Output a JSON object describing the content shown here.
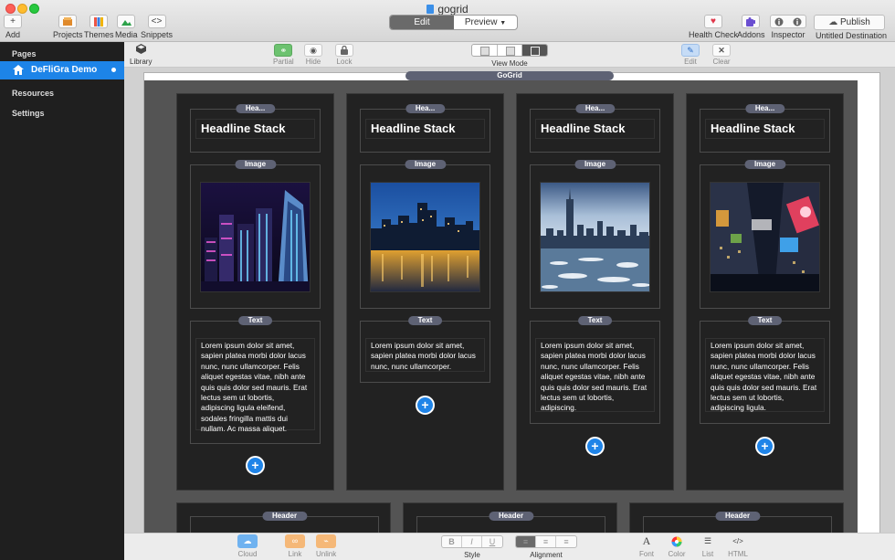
{
  "window": {
    "title": "gogrid"
  },
  "toolbar": {
    "add": "Add",
    "projects": "Projects",
    "themes": "Themes",
    "media": "Media",
    "snippets": "Snippets",
    "edit": "Edit",
    "preview": "Preview",
    "health_check": "Health Check",
    "addons": "Addons",
    "inspector": "Inspector",
    "publish": "Publish",
    "destination": "Untitled Destination"
  },
  "sidebar": {
    "pages_heading": "Pages",
    "page_item": "DeFliGra Demo",
    "resources": "Resources",
    "settings": "Settings"
  },
  "subbar": {
    "library": "Library",
    "partial": "Partial",
    "hide": "Hide",
    "lock": "Lock",
    "view_mode": "View Mode",
    "edit": "Edit",
    "clear": "Clear"
  },
  "canvas": {
    "gogrid_tag": "GoGrid",
    "columns": [
      {
        "header_tag": "Hea...",
        "headline": "Headline Stack",
        "image_tag": "Image",
        "text_tag": "Text",
        "text": "Lorem ipsum dolor sit amet, sapien platea morbi dolor lacus nunc, nunc ullamcorper. Felis aliquet egestas vitae, nibh ante quis quis dolor sed mauris. Erat lectus sem ut lobortis, adipiscing ligula eleifend, sodales fringilla mattis dui nullam. Ac massa aliquet."
      },
      {
        "header_tag": "Hea...",
        "headline": "Headline Stack",
        "image_tag": "Image",
        "text_tag": "Text",
        "text": "Lorem ipsum dolor sit amet, sapien platea morbi dolor lacus nunc, nunc ullamcorper."
      },
      {
        "header_tag": "Hea...",
        "headline": "Headline Stack",
        "image_tag": "Image",
        "text_tag": "Text",
        "text": "Lorem ipsum dolor sit amet, sapien platea morbi dolor lacus nunc, nunc ullamcorper. Felis aliquet egestas vitae, nibh ante quis quis dolor sed mauris. Erat lectus sem ut lobortis, adipiscing."
      },
      {
        "header_tag": "Hea...",
        "headline": "Headline Stack",
        "image_tag": "Image",
        "text_tag": "Text",
        "text": "Lorem ipsum dolor sit amet, sapien platea morbi dolor lacus nunc, nunc ullamcorper. Felis aliquet egestas vitae, nibh ante quis quis dolor sed mauris. Erat lectus sem ut lobortis, adipiscing ligula."
      }
    ],
    "header_row_tags": [
      "Header",
      "Header",
      "Header"
    ]
  },
  "bottombar": {
    "cloud": "Cloud",
    "link": "Link",
    "unlink": "Unlink",
    "style": "Style",
    "alignment": "Alignment",
    "font": "Font",
    "color": "Color",
    "list": "List",
    "html": "HTML",
    "bold": "B",
    "italic": "I",
    "underline": "U"
  },
  "icons": {
    "add": "+",
    "snippets": "<>",
    "html": "</>",
    "font": "A",
    "add_stack": "+"
  }
}
